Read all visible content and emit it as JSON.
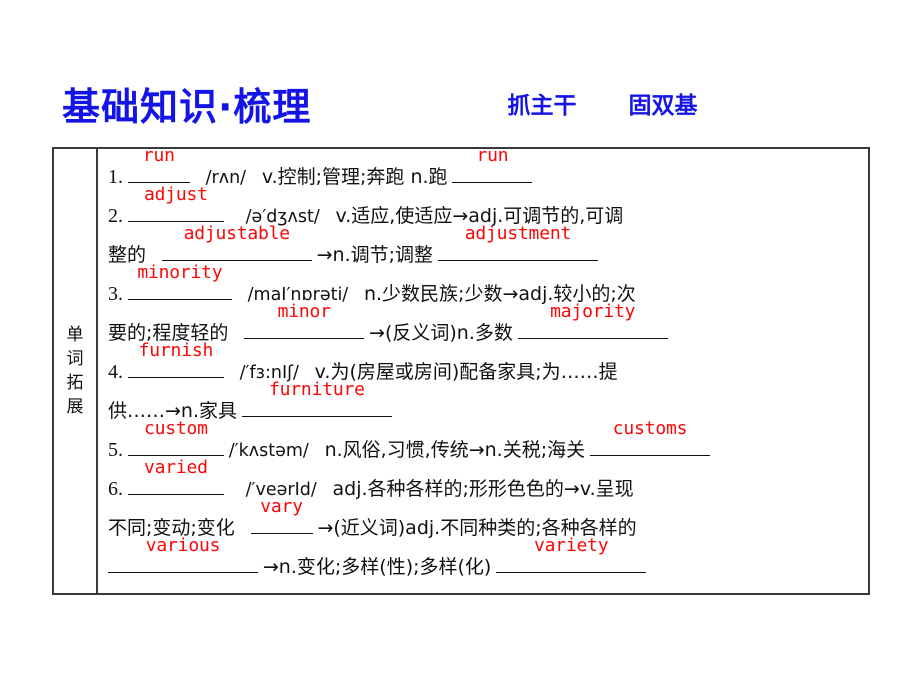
{
  "header": {
    "title": "基础知识·梳理",
    "sub_left": "抓主干",
    "sub_right": "固双基"
  },
  "table": {
    "row_label_chars": [
      "单",
      "词",
      "拓",
      "展"
    ],
    "entries": [
      {
        "index": "1.",
        "answer1": "run",
        "ipa": "/rʌn/",
        "def": "v.控制;管理;奔跑 n.跑",
        "answer2": "run"
      },
      {
        "index": "2.",
        "answer1": "adjust",
        "ipa": "/ə′dʒʌst/",
        "def_line1": "v.适应,使适应→adj.可调节的,可调",
        "def_line2_pre": "整的",
        "answer2": "adjustable",
        "def_line2_mid": "→n.调节;调整",
        "answer3": "adjustment"
      },
      {
        "index": "3.",
        "answer1": "minority",
        "ipa": "/maI′nɒrəti/",
        "def_line1": "n.少数民族;少数→adj.较小的;次",
        "def_line2_pre": "要的;程度轻的",
        "answer2": "minor",
        "def_line2_mid": "→(反义词)n.多数",
        "answer3": "majority"
      },
      {
        "index": "4.",
        "answer1": "furnish",
        "ipa": "/′fɜ:nIʃ/",
        "def_line1": "v.为(房屋或房间)配备家具;为……提",
        "def_line2_pre": "供……→n.家具",
        "answer2": "furniture"
      },
      {
        "index": "5.",
        "answer1": "custom",
        "ipa": "/′kʌstəm/",
        "def": "n.风俗,习惯,传统→n.关税;海关",
        "answer2": "customs"
      },
      {
        "index": "6.",
        "answer1": "varied",
        "ipa": "/′veərId/",
        "def_line1": "adj.各种各样的;形形色色的→v.呈现",
        "def_line2_pre": "不同;变动;变化",
        "answer2": "vary",
        "def_line2_mid": "→(近义词)adj.不同种类的;各种各样的",
        "answer3": "various",
        "def_line3_mid": "→n.变化;多样(性);多样(化)",
        "answer4": "variety"
      }
    ]
  },
  "colors": {
    "heading_blue": "#1414e6",
    "answer_red": "#fb0707",
    "border_gray": "#3a3a3a",
    "text_black": "#111111"
  }
}
